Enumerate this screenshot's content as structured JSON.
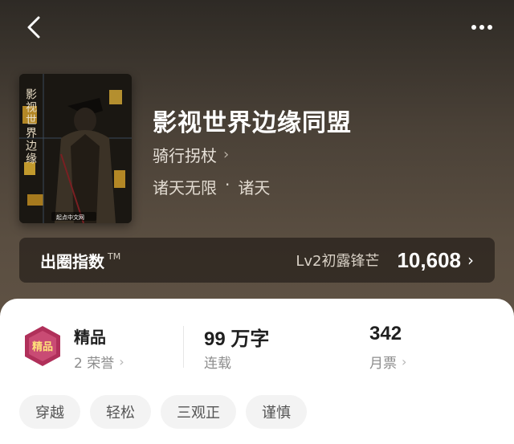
{
  "header": {
    "back_icon": "chevron-left-icon",
    "more_icon": "more-dots-icon"
  },
  "book": {
    "title": "影视世界边缘同盟",
    "author": "骑行拐杖",
    "genre_primary": "诸天无限",
    "genre_separator": "·",
    "genre_secondary": "诸天",
    "cover_text": "影视世界边缘",
    "cover_publisher": "起点中文网"
  },
  "index": {
    "label": "出圈指数",
    "tm": "TM",
    "level": "Lv2初露锋芒",
    "value": "10,608"
  },
  "stats": {
    "quality": {
      "title": "精品",
      "sub": "2 荣誉"
    },
    "badge_text": "精品",
    "words": {
      "title": "99 万字",
      "sub": "连载"
    },
    "tickets": {
      "title": "342",
      "sub": "月票"
    }
  },
  "tags": [
    "穿越",
    "轻松",
    "三观正",
    "谨慎"
  ],
  "colors": {
    "hero_dark": "#2e2a25",
    "hero_light": "#5f5244",
    "badge": "#b0305a"
  }
}
